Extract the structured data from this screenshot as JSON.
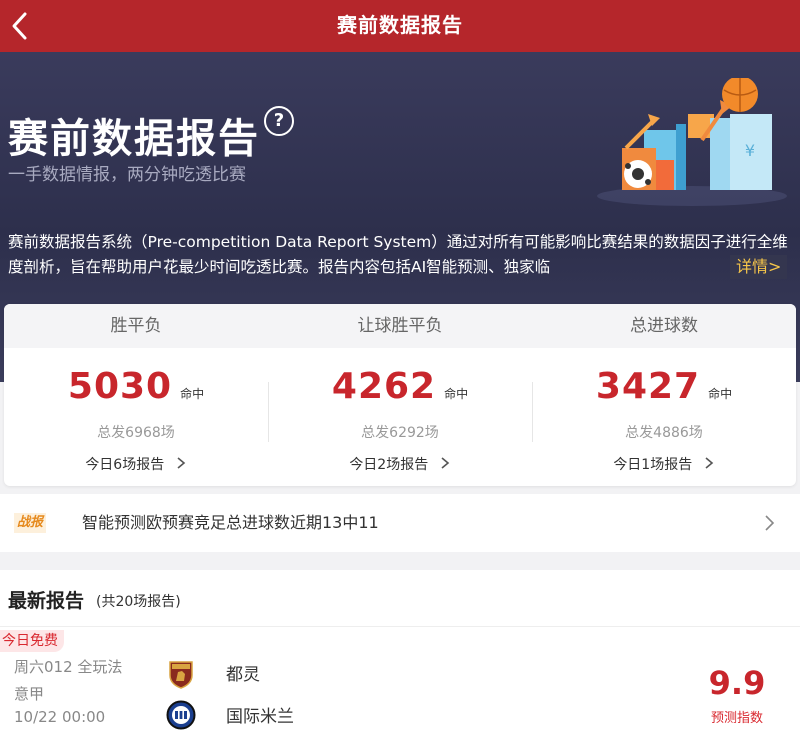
{
  "topbar": {
    "title": "赛前数据报告"
  },
  "hero": {
    "title": "赛前数据报告",
    "help_glyph": "?",
    "subtitle": "一手数据情报，两分钟吃透比赛",
    "description": "赛前数据报告系统（Pre-competition Data Report System）通过对所有可能影响比赛结果的数据因子进行全维度剖析，旨在帮助用户花最少时间吃透比赛。报告内容包括AI智能预测、独家临",
    "detail_link": "详情>"
  },
  "stats": [
    {
      "label": "胜平负",
      "hits": "5030",
      "unit": "命中",
      "total": "总发6968场",
      "today": "今日6场报告"
    },
    {
      "label": "让球胜平负",
      "hits": "4262",
      "unit": "命中",
      "total": "总发6292场",
      "today": "今日2场报告"
    },
    {
      "label": "总进球数",
      "hits": "3427",
      "unit": "命中",
      "total": "总发4886场",
      "today": "今日1场报告"
    }
  ],
  "battle": {
    "tag": "战报",
    "text": "智能预测欧预赛竞足总进球数近期13中11"
  },
  "latest": {
    "title": "最新报告",
    "count": "(共20场报告)",
    "match": {
      "badge": "今日免费",
      "line1": "周六012   全玩法",
      "line2": "意甲",
      "line3": "10/22 00:00",
      "home": "都灵",
      "away": "国际米兰",
      "score": "9.9",
      "score_label": "预测指数"
    }
  },
  "colors": {
    "brand_red": "#b5262b",
    "number_red": "#c8262c",
    "hero_bg": "#2d2f4c",
    "link_gold": "#f6c64a"
  },
  "icons": {
    "back": "chevron-left-icon",
    "help": "question-circle-icon",
    "chevron": "chevron-right-icon"
  }
}
